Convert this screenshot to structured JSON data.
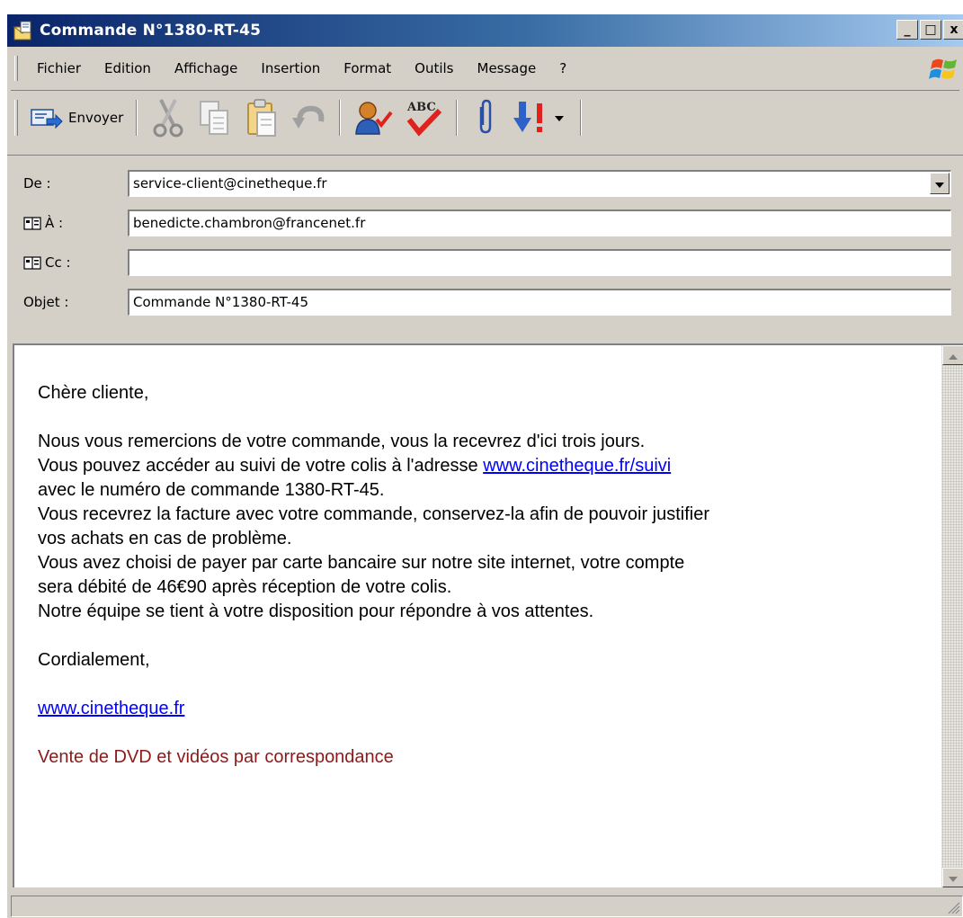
{
  "window": {
    "title": "Commande N°1380-RT-45",
    "minimize": "_",
    "maximize": "□",
    "close": "x"
  },
  "menu": {
    "items": [
      "Fichier",
      "Edition",
      "Affichage",
      "Insertion",
      "Format",
      "Outils",
      "Message",
      "?"
    ]
  },
  "toolbar": {
    "send_label": "Envoyer",
    "icons": [
      "send-icon",
      "cut-icon",
      "copy-icon",
      "paste-icon",
      "undo-icon",
      "check-names-icon",
      "spelling-icon",
      "attach-icon",
      "priority-icon"
    ]
  },
  "fields": {
    "from_label": "De :",
    "from_value": "service-client@cinetheque.fr",
    "to_label": "À :",
    "to_value": "benedicte.chambron@francenet.fr",
    "cc_label": "Cc :",
    "cc_value": "",
    "subject_label": "Objet :",
    "subject_value": "Commande N°1380-RT-45"
  },
  "message": {
    "greeting": "Chère cliente,",
    "line1": "Nous vous remercions de votre commande, vous la recevrez d'ici trois jours.",
    "line2_pre": "Vous pouvez accéder au suivi de votre colis à l'adresse ",
    "line2_link": "www.cinetheque.fr/suivi",
    "line3": "avec le numéro de commande 1380-RT-45.",
    "line4": "Vous recevrez la facture avec votre commande, conservez-la afin de pouvoir justifier",
    "line5": "vos achats en cas de problème.",
    "line6": "Vous avez choisi de payer par carte bancaire sur notre site internet, votre compte",
    "line7": "sera débité de 46€90 après réception de votre colis.",
    "line8": "Notre équipe se tient à votre disposition pour répondre à vos attentes.",
    "closing": "Cordialement,",
    "website": "www.cinetheque.fr",
    "tagline": "Vente de DVD et vidéos par correspondance"
  },
  "colors": {
    "link": "#0000ff",
    "tagline": "#8b1a1a",
    "titlebar_start": "#0a246a",
    "titlebar_end": "#a6caf0"
  }
}
